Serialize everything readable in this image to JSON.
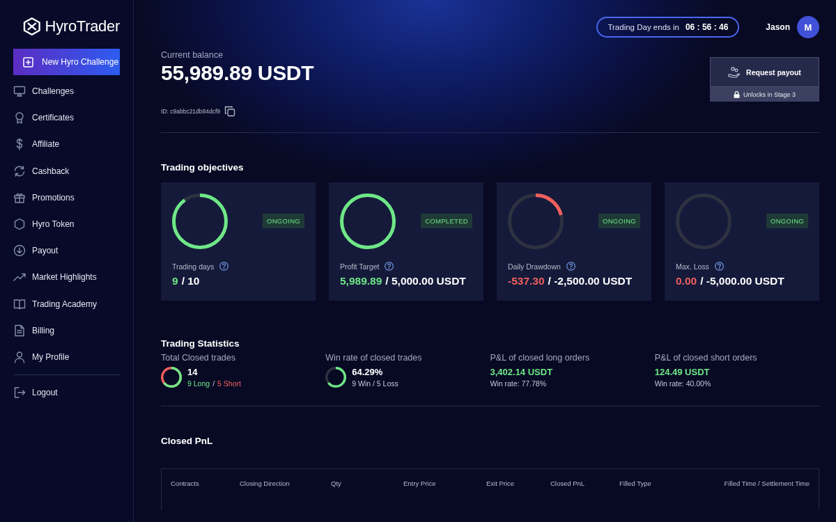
{
  "sidebar": {
    "logo": "HyroTrader",
    "new_challenge_button": "New Hyro Challenge",
    "items": [
      {
        "label": "Challenges"
      },
      {
        "label": "Certificates"
      },
      {
        "label": "Affiliate"
      },
      {
        "label": "Cashback"
      },
      {
        "label": "Promotions"
      },
      {
        "label": "Hyro Token"
      },
      {
        "label": "Payout"
      },
      {
        "label": "Market Highlights"
      },
      {
        "label": "Trading Academy"
      },
      {
        "label": "Billing"
      },
      {
        "label": "My Profile"
      }
    ],
    "logout": "Logout"
  },
  "header": {
    "timer_label": "Trading Day ends in",
    "timer_value": "06 : 56 : 46",
    "user_name": "Jason",
    "avatar_initial": "M"
  },
  "balance": {
    "label": "Current balance",
    "value": "55,989.89 USDT",
    "id": "ID: c9abbc21db84dcf9"
  },
  "payout": {
    "button": "Request payout",
    "lock_note": "Unlocks in Stage 3"
  },
  "objectives": {
    "title": "Trading objectives",
    "items": [
      {
        "label": "Trading days",
        "status": "ONGOING",
        "level": 0.9,
        "color": "#6ee787",
        "current": "9",
        "target": "/ 10"
      },
      {
        "label": "Profit Target",
        "status": "COMPLETED",
        "level": 1,
        "color": "#6ee787",
        "current": "5,989.89",
        "target": "/ 5,000.00 USDT"
      },
      {
        "label": "Daily Drawdown",
        "status": "ONGOING",
        "level": 0.21,
        "color": "#f0605d",
        "current": "-537.30",
        "target": "/ -2,500.00 USDT"
      },
      {
        "label": "Max. Loss",
        "status": "ONGOING",
        "level": 0,
        "color": "#f0605d",
        "current": "0.00",
        "target": "/ -5,000.00 USDT"
      }
    ]
  },
  "statistics": {
    "title": "Trading Statistics",
    "items": [
      {
        "kind": "split",
        "label": "Total Closed trades",
        "level": 0.643,
        "value": "14",
        "long": "9 Long",
        "separator": "/",
        "short": "5 Short"
      },
      {
        "kind": "ring",
        "label": "Win rate of closed trades",
        "level": 0.643,
        "value": "64.29%",
        "detail": "9 Win / 5 Loss"
      },
      {
        "kind": "pnl",
        "label": "P&L of closed long orders",
        "value": "3,402.14 USDT",
        "detail": "Win rate: 77.78%"
      },
      {
        "kind": "pnl",
        "label": "P&L of closed short orders",
        "value": "124.49 USDT",
        "detail": "Win rate: 40.00%"
      }
    ]
  },
  "closed_pnl": {
    "title": "Closed PnL",
    "columns": [
      "Contracts",
      "Closing Direction",
      "Qty",
      "Entry Price",
      "Exit Price",
      "Closed PnL",
      "Filled Type",
      "Filled Time / Settlement Time"
    ]
  }
}
